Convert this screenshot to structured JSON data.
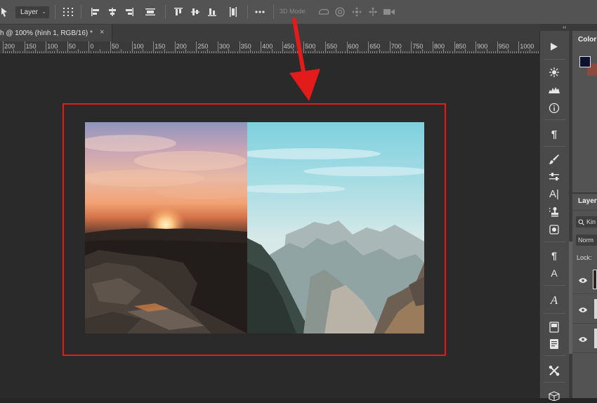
{
  "options_bar": {
    "layer_dropdown": "Layer",
    "mode_3d_label": "3D Mode:",
    "icons": [
      "move-tool-icon",
      "transform-grid-icon",
      "align-left-icon",
      "align-center-icon",
      "align-right-icon",
      "distribute-horizontal-icon",
      "align-top-icon",
      "align-middle-icon",
      "align-bottom-icon",
      "distribute-vertical-icon",
      "more-options-icon",
      "orbit-3d-icon",
      "roll-3d-icon",
      "pan-3d-icon",
      "slide-3d-icon",
      "scale-3d-icon"
    ]
  },
  "document_tab": {
    "title": "h @ 100% (hình 1, RGB/16) *",
    "close_label": "×"
  },
  "ruler": {
    "labels": [
      "200",
      "150",
      "100",
      "50",
      "0",
      "50",
      "100",
      "150",
      "200",
      "250",
      "300",
      "350",
      "400",
      "450",
      "500",
      "550",
      "600",
      "650",
      "700",
      "750",
      "800",
      "850",
      "900",
      "950",
      "1000"
    ]
  },
  "colors": {
    "highlight": "#e31b1b",
    "arrow": "#e31b1b",
    "foreground_swatch": "#0e1030",
    "background_swatch": "#8a4a40"
  },
  "panels": {
    "collapse_label": "‹‹",
    "color_title": "Color",
    "layers_title": "Layers",
    "search_label": "Kin",
    "blend_mode": "Norm",
    "lock_label": "Lock:"
  },
  "toolstrip": {
    "icons": [
      "play-icon",
      "sun-icon",
      "histogram-icon",
      "info-icon",
      "paragraph-icon",
      "brush-icon",
      "sliders-icon",
      "character-icon",
      "clone-stamp-icon",
      "adjustments-icon",
      "paragraph-style-icon",
      "character-style-icon",
      "glyphs-icon",
      "navigator-icon",
      "notes-icon",
      "tools-icon",
      "3d-cube-icon"
    ]
  }
}
